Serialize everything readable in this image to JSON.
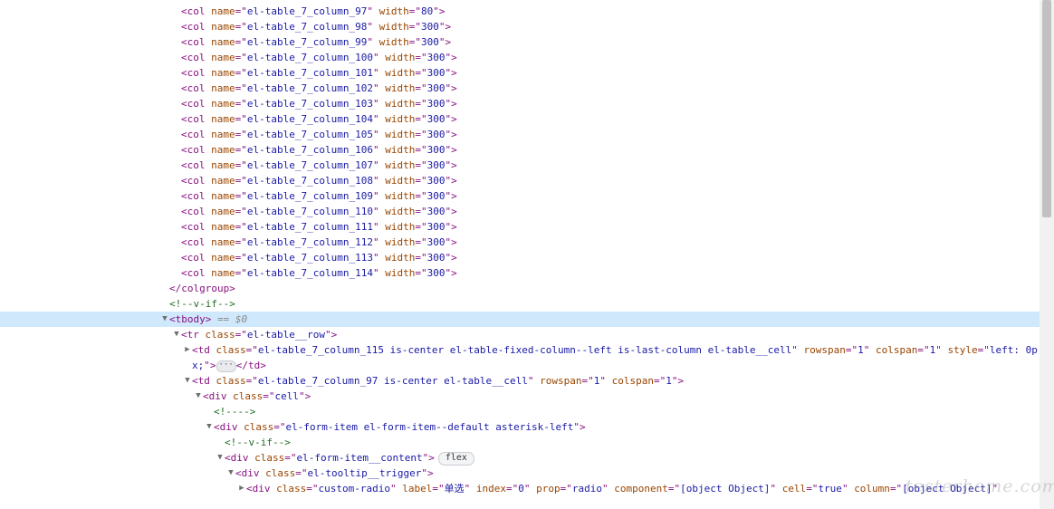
{
  "lines": [
    {
      "indent": 200,
      "tw": "",
      "parts": [
        [
          "tag",
          "<col "
        ],
        [
          "an",
          "name"
        ],
        [
          "tag",
          "=\""
        ],
        [
          "av",
          "el-table_7_column_97"
        ],
        [
          "tag",
          "\" "
        ],
        [
          "an",
          "width"
        ],
        [
          "tag",
          "=\""
        ],
        [
          "av",
          "80"
        ],
        [
          "tag",
          "\">"
        ]
      ]
    },
    {
      "indent": 200,
      "tw": "",
      "parts": [
        [
          "tag",
          "<col "
        ],
        [
          "an",
          "name"
        ],
        [
          "tag",
          "=\""
        ],
        [
          "av",
          "el-table_7_column_98"
        ],
        [
          "tag",
          "\" "
        ],
        [
          "an",
          "width"
        ],
        [
          "tag",
          "=\""
        ],
        [
          "av",
          "300"
        ],
        [
          "tag",
          "\">"
        ]
      ]
    },
    {
      "indent": 200,
      "tw": "",
      "parts": [
        [
          "tag",
          "<col "
        ],
        [
          "an",
          "name"
        ],
        [
          "tag",
          "=\""
        ],
        [
          "av",
          "el-table_7_column_99"
        ],
        [
          "tag",
          "\" "
        ],
        [
          "an",
          "width"
        ],
        [
          "tag",
          "=\""
        ],
        [
          "av",
          "300"
        ],
        [
          "tag",
          "\">"
        ]
      ]
    },
    {
      "indent": 200,
      "tw": "",
      "parts": [
        [
          "tag",
          "<col "
        ],
        [
          "an",
          "name"
        ],
        [
          "tag",
          "=\""
        ],
        [
          "av",
          "el-table_7_column_100"
        ],
        [
          "tag",
          "\" "
        ],
        [
          "an",
          "width"
        ],
        [
          "tag",
          "=\""
        ],
        [
          "av",
          "300"
        ],
        [
          "tag",
          "\">"
        ]
      ]
    },
    {
      "indent": 200,
      "tw": "",
      "parts": [
        [
          "tag",
          "<col "
        ],
        [
          "an",
          "name"
        ],
        [
          "tag",
          "=\""
        ],
        [
          "av",
          "el-table_7_column_101"
        ],
        [
          "tag",
          "\" "
        ],
        [
          "an",
          "width"
        ],
        [
          "tag",
          "=\""
        ],
        [
          "av",
          "300"
        ],
        [
          "tag",
          "\">"
        ]
      ]
    },
    {
      "indent": 200,
      "tw": "",
      "parts": [
        [
          "tag",
          "<col "
        ],
        [
          "an",
          "name"
        ],
        [
          "tag",
          "=\""
        ],
        [
          "av",
          "el-table_7_column_102"
        ],
        [
          "tag",
          "\" "
        ],
        [
          "an",
          "width"
        ],
        [
          "tag",
          "=\""
        ],
        [
          "av",
          "300"
        ],
        [
          "tag",
          "\">"
        ]
      ]
    },
    {
      "indent": 200,
      "tw": "",
      "parts": [
        [
          "tag",
          "<col "
        ],
        [
          "an",
          "name"
        ],
        [
          "tag",
          "=\""
        ],
        [
          "av",
          "el-table_7_column_103"
        ],
        [
          "tag",
          "\" "
        ],
        [
          "an",
          "width"
        ],
        [
          "tag",
          "=\""
        ],
        [
          "av",
          "300"
        ],
        [
          "tag",
          "\">"
        ]
      ]
    },
    {
      "indent": 200,
      "tw": "",
      "parts": [
        [
          "tag",
          "<col "
        ],
        [
          "an",
          "name"
        ],
        [
          "tag",
          "=\""
        ],
        [
          "av",
          "el-table_7_column_104"
        ],
        [
          "tag",
          "\" "
        ],
        [
          "an",
          "width"
        ],
        [
          "tag",
          "=\""
        ],
        [
          "av",
          "300"
        ],
        [
          "tag",
          "\">"
        ]
      ]
    },
    {
      "indent": 200,
      "tw": "",
      "parts": [
        [
          "tag",
          "<col "
        ],
        [
          "an",
          "name"
        ],
        [
          "tag",
          "=\""
        ],
        [
          "av",
          "el-table_7_column_105"
        ],
        [
          "tag",
          "\" "
        ],
        [
          "an",
          "width"
        ],
        [
          "tag",
          "=\""
        ],
        [
          "av",
          "300"
        ],
        [
          "tag",
          "\">"
        ]
      ]
    },
    {
      "indent": 200,
      "tw": "",
      "parts": [
        [
          "tag",
          "<col "
        ],
        [
          "an",
          "name"
        ],
        [
          "tag",
          "=\""
        ],
        [
          "av",
          "el-table_7_column_106"
        ],
        [
          "tag",
          "\" "
        ],
        [
          "an",
          "width"
        ],
        [
          "tag",
          "=\""
        ],
        [
          "av",
          "300"
        ],
        [
          "tag",
          "\">"
        ]
      ]
    },
    {
      "indent": 200,
      "tw": "",
      "parts": [
        [
          "tag",
          "<col "
        ],
        [
          "an",
          "name"
        ],
        [
          "tag",
          "=\""
        ],
        [
          "av",
          "el-table_7_column_107"
        ],
        [
          "tag",
          "\" "
        ],
        [
          "an",
          "width"
        ],
        [
          "tag",
          "=\""
        ],
        [
          "av",
          "300"
        ],
        [
          "tag",
          "\">"
        ]
      ]
    },
    {
      "indent": 200,
      "tw": "",
      "parts": [
        [
          "tag",
          "<col "
        ],
        [
          "an",
          "name"
        ],
        [
          "tag",
          "=\""
        ],
        [
          "av",
          "el-table_7_column_108"
        ],
        [
          "tag",
          "\" "
        ],
        [
          "an",
          "width"
        ],
        [
          "tag",
          "=\""
        ],
        [
          "av",
          "300"
        ],
        [
          "tag",
          "\">"
        ]
      ]
    },
    {
      "indent": 200,
      "tw": "",
      "parts": [
        [
          "tag",
          "<col "
        ],
        [
          "an",
          "name"
        ],
        [
          "tag",
          "=\""
        ],
        [
          "av",
          "el-table_7_column_109"
        ],
        [
          "tag",
          "\" "
        ],
        [
          "an",
          "width"
        ],
        [
          "tag",
          "=\""
        ],
        [
          "av",
          "300"
        ],
        [
          "tag",
          "\">"
        ]
      ]
    },
    {
      "indent": 200,
      "tw": "",
      "parts": [
        [
          "tag",
          "<col "
        ],
        [
          "an",
          "name"
        ],
        [
          "tag",
          "=\""
        ],
        [
          "av",
          "el-table_7_column_110"
        ],
        [
          "tag",
          "\" "
        ],
        [
          "an",
          "width"
        ],
        [
          "tag",
          "=\""
        ],
        [
          "av",
          "300"
        ],
        [
          "tag",
          "\">"
        ]
      ]
    },
    {
      "indent": 200,
      "tw": "",
      "parts": [
        [
          "tag",
          "<col "
        ],
        [
          "an",
          "name"
        ],
        [
          "tag",
          "=\""
        ],
        [
          "av",
          "el-table_7_column_111"
        ],
        [
          "tag",
          "\" "
        ],
        [
          "an",
          "width"
        ],
        [
          "tag",
          "=\""
        ],
        [
          "av",
          "300"
        ],
        [
          "tag",
          "\">"
        ]
      ]
    },
    {
      "indent": 200,
      "tw": "",
      "parts": [
        [
          "tag",
          "<col "
        ],
        [
          "an",
          "name"
        ],
        [
          "tag",
          "=\""
        ],
        [
          "av",
          "el-table_7_column_112"
        ],
        [
          "tag",
          "\" "
        ],
        [
          "an",
          "width"
        ],
        [
          "tag",
          "=\""
        ],
        [
          "av",
          "300"
        ],
        [
          "tag",
          "\">"
        ]
      ]
    },
    {
      "indent": 200,
      "tw": "",
      "parts": [
        [
          "tag",
          "<col "
        ],
        [
          "an",
          "name"
        ],
        [
          "tag",
          "=\""
        ],
        [
          "av",
          "el-table_7_column_113"
        ],
        [
          "tag",
          "\" "
        ],
        [
          "an",
          "width"
        ],
        [
          "tag",
          "=\""
        ],
        [
          "av",
          "300"
        ],
        [
          "tag",
          "\">"
        ]
      ]
    },
    {
      "indent": 200,
      "tw": "",
      "parts": [
        [
          "tag",
          "<col "
        ],
        [
          "an",
          "name"
        ],
        [
          "tag",
          "=\""
        ],
        [
          "av",
          "el-table_7_column_114"
        ],
        [
          "tag",
          "\" "
        ],
        [
          "an",
          "width"
        ],
        [
          "tag",
          "=\""
        ],
        [
          "av",
          "300"
        ],
        [
          "tag",
          "\">"
        ]
      ]
    },
    {
      "indent": 187,
      "tw": "",
      "parts": [
        [
          "tag",
          "</colgroup>"
        ]
      ]
    },
    {
      "indent": 187,
      "tw": "",
      "parts": [
        [
          "cm",
          "<!--v-if-->"
        ]
      ]
    },
    {
      "indent": 187,
      "tw": "▼",
      "selected": true,
      "parts": [
        [
          "tag",
          "<tbody>"
        ],
        [
          "dim",
          " == $0"
        ]
      ]
    },
    {
      "indent": 200,
      "tw": "▼",
      "parts": [
        [
          "tag",
          "<tr "
        ],
        [
          "an",
          "class"
        ],
        [
          "tag",
          "=\""
        ],
        [
          "av",
          "el-table__row"
        ],
        [
          "tag",
          "\">"
        ]
      ]
    },
    {
      "indent": 212,
      "tw": "▶",
      "parts": [
        [
          "tag",
          "<td "
        ],
        [
          "an",
          "class"
        ],
        [
          "tag",
          "=\""
        ],
        [
          "av",
          "el-table_7_column_115 is-center el-table-fixed-column--left is-last-column el-table__cell"
        ],
        [
          "tag",
          "\" "
        ],
        [
          "an",
          "rowspan"
        ],
        [
          "tag",
          "=\""
        ],
        [
          "av",
          "1"
        ],
        [
          "tag",
          "\" "
        ],
        [
          "an",
          "colspan"
        ],
        [
          "tag",
          "=\""
        ],
        [
          "av",
          "1"
        ],
        [
          "tag",
          "\" "
        ],
        [
          "an",
          "style"
        ],
        [
          "tag",
          "=\""
        ],
        [
          "av",
          "left: 0p"
        ]
      ]
    },
    {
      "indent": 212,
      "tw": "",
      "parts": [
        [
          "av",
          "x;"
        ],
        [
          "tag",
          "\">"
        ],
        [
          "ell",
          "···"
        ],
        [
          "tag",
          "</td>"
        ]
      ]
    },
    {
      "indent": 212,
      "tw": "▼",
      "parts": [
        [
          "tag",
          "<td "
        ],
        [
          "an",
          "class"
        ],
        [
          "tag",
          "=\""
        ],
        [
          "av",
          "el-table_7_column_97 is-center el-table__cell"
        ],
        [
          "tag",
          "\" "
        ],
        [
          "an",
          "rowspan"
        ],
        [
          "tag",
          "=\""
        ],
        [
          "av",
          "1"
        ],
        [
          "tag",
          "\" "
        ],
        [
          "an",
          "colspan"
        ],
        [
          "tag",
          "=\""
        ],
        [
          "av",
          "1"
        ],
        [
          "tag",
          "\">"
        ]
      ]
    },
    {
      "indent": 224,
      "tw": "▼",
      "parts": [
        [
          "tag",
          "<div "
        ],
        [
          "an",
          "class"
        ],
        [
          "tag",
          "=\""
        ],
        [
          "av",
          "cell"
        ],
        [
          "tag",
          "\">"
        ]
      ]
    },
    {
      "indent": 236,
      "tw": "",
      "parts": [
        [
          "cm",
          "<!---->"
        ]
      ]
    },
    {
      "indent": 236,
      "tw": "▼",
      "parts": [
        [
          "tag",
          "<div "
        ],
        [
          "an",
          "class"
        ],
        [
          "tag",
          "=\""
        ],
        [
          "av",
          "el-form-item el-form-item--default asterisk-left"
        ],
        [
          "tag",
          "\">"
        ]
      ]
    },
    {
      "indent": 248,
      "tw": "",
      "parts": [
        [
          "cm",
          "<!--v-if-->"
        ]
      ]
    },
    {
      "indent": 248,
      "tw": "▼",
      "parts": [
        [
          "tag",
          "<div "
        ],
        [
          "an",
          "class"
        ],
        [
          "tag",
          "=\""
        ],
        [
          "av",
          "el-form-item__content"
        ],
        [
          "tag",
          "\">"
        ],
        [
          "badge",
          "flex"
        ]
      ]
    },
    {
      "indent": 260,
      "tw": "▼",
      "parts": [
        [
          "tag",
          "<div "
        ],
        [
          "an",
          "class"
        ],
        [
          "tag",
          "=\""
        ],
        [
          "av",
          "el-tooltip__trigger"
        ],
        [
          "tag",
          "\">"
        ]
      ]
    },
    {
      "indent": 272,
      "tw": "▶",
      "parts": [
        [
          "tag",
          "<div "
        ],
        [
          "an",
          "class"
        ],
        [
          "tag",
          "=\""
        ],
        [
          "av",
          "custom-radio"
        ],
        [
          "tag",
          "\" "
        ],
        [
          "an",
          "label"
        ],
        [
          "tag",
          "=\""
        ],
        [
          "av",
          "单选"
        ],
        [
          "tag",
          "\" "
        ],
        [
          "an",
          "index"
        ],
        [
          "tag",
          "=\""
        ],
        [
          "av",
          "0"
        ],
        [
          "tag",
          "\" "
        ],
        [
          "an",
          "prop"
        ],
        [
          "tag",
          "=\""
        ],
        [
          "av",
          "radio"
        ],
        [
          "tag",
          "\" "
        ],
        [
          "an",
          "component"
        ],
        [
          "tag",
          "=\""
        ],
        [
          "av",
          "[object Object]"
        ],
        [
          "tag",
          "\" "
        ],
        [
          "an",
          "cell"
        ],
        [
          "tag",
          "=\""
        ],
        [
          "av",
          "true"
        ],
        [
          "tag",
          "\" "
        ],
        [
          "an",
          "column"
        ],
        [
          "tag",
          "=\""
        ],
        [
          "av",
          "[object Object]"
        ],
        [
          "tag",
          "\""
        ]
      ]
    }
  ],
  "watermark": "testerhome.com"
}
